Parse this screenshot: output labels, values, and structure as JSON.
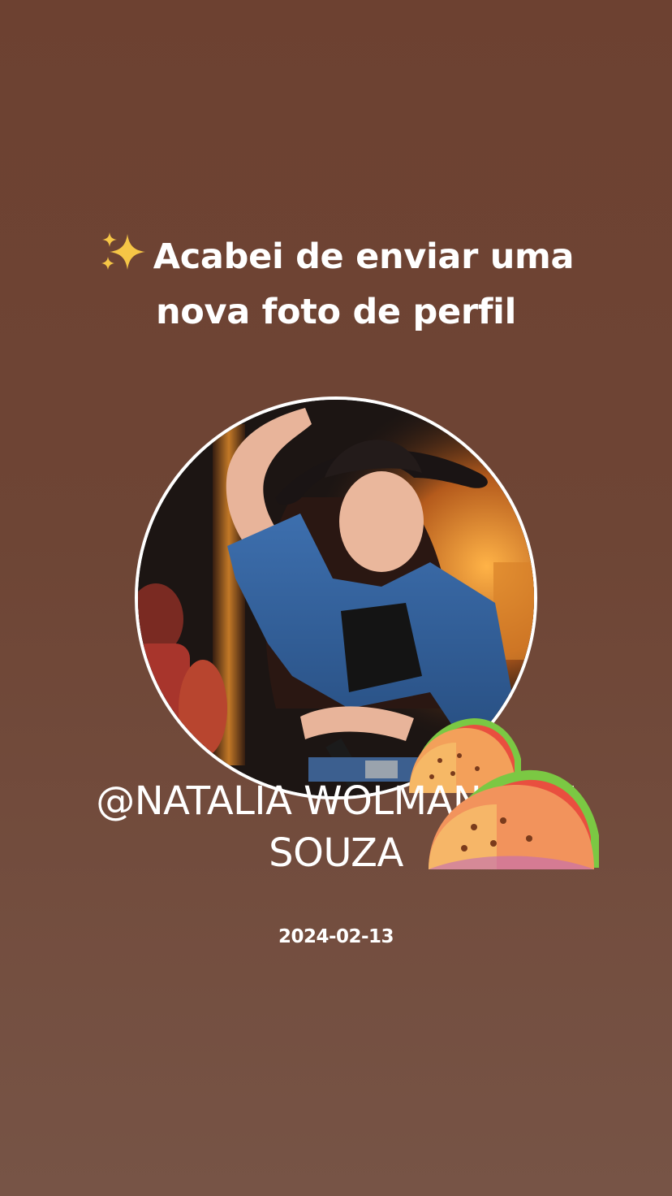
{
  "post": {
    "headline_line1": "Acabei de enviar uma",
    "headline_line2": "nova foto de perfil",
    "sparkle_icon": "sparkles-emoji",
    "profile_photo": "profile-photo-cowgirl-singer",
    "username_line1": "@NATALIA WOLMANN DE",
    "username_line2": "SOUZA",
    "taco_icon": "taco-emoji",
    "date": "2024-02-13"
  },
  "colors": {
    "background_top": "#6d4131",
    "background_bottom": "#775446",
    "text": "#ffffff",
    "sparkle": "#f6c646"
  }
}
